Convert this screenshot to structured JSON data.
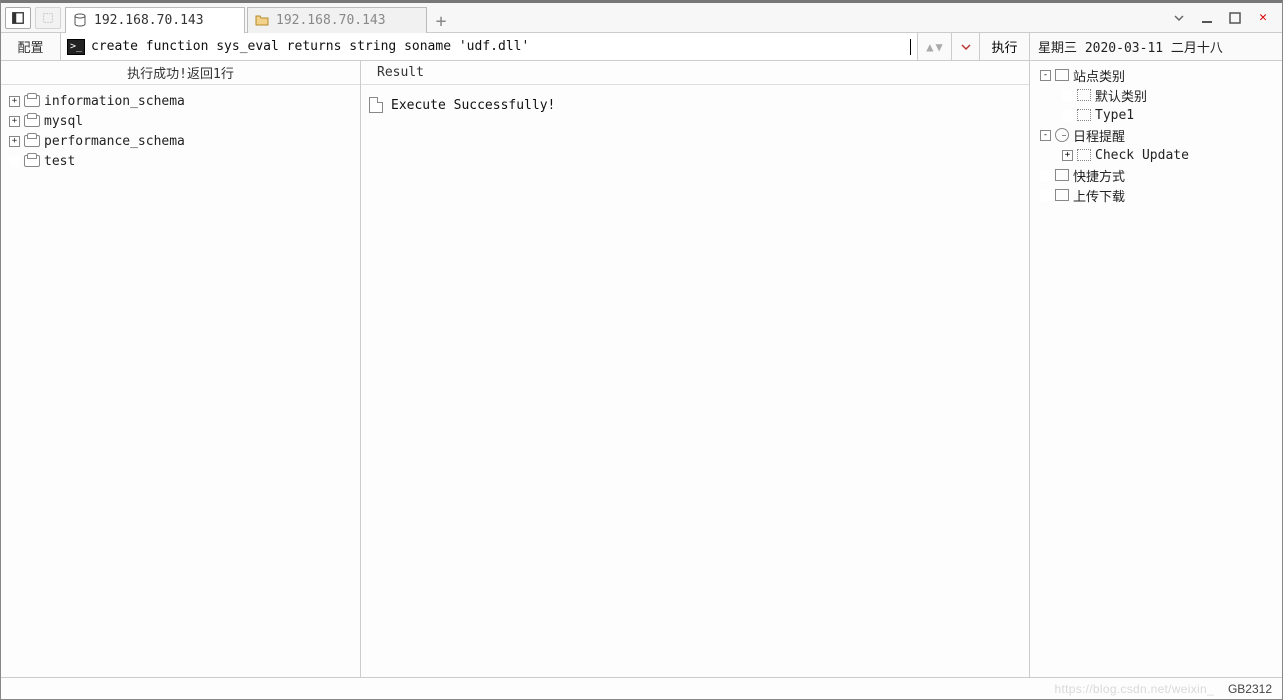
{
  "tabs": [
    {
      "label": "192.168.70.143",
      "active": true,
      "icon": "db"
    },
    {
      "label": "192.168.70.143",
      "active": false,
      "icon": "folder"
    }
  ],
  "cmdbar": {
    "config_label": "配置",
    "command": "create function sys_eval returns string soname 'udf.dll'",
    "exec_label": "执行",
    "date_text": "星期三 2020-03-11 二月十八"
  },
  "left_panel": {
    "header": "执行成功!返回1行",
    "items": [
      {
        "label": "information_schema",
        "expandable": true
      },
      {
        "label": "mysql",
        "expandable": true
      },
      {
        "label": "performance_schema",
        "expandable": true
      },
      {
        "label": "test",
        "expandable": false
      }
    ]
  },
  "mid_panel": {
    "header": "Result",
    "rows": [
      {
        "text": "Execute Successfully!"
      }
    ]
  },
  "right_panel": {
    "nodes": [
      {
        "depth": 1,
        "exp": "-",
        "icon": "square",
        "label": "站点类别"
      },
      {
        "depth": 2,
        "exp": "",
        "icon": "dashed",
        "label": "默认类别"
      },
      {
        "depth": 2,
        "exp": "",
        "icon": "dashed",
        "label": "Type1"
      },
      {
        "depth": 1,
        "exp": "-",
        "icon": "clock",
        "label": "日程提醒"
      },
      {
        "depth": 2,
        "exp": "+",
        "icon": "dashed",
        "label": "Check Update"
      },
      {
        "depth": 1,
        "exp": "",
        "icon": "square",
        "label": "快捷方式"
      },
      {
        "depth": 1,
        "exp": "",
        "icon": "square",
        "label": "上传下载"
      }
    ]
  },
  "status": {
    "watermark": "https://blog.csdn.net/weixin_",
    "encoding": "GB2312"
  }
}
